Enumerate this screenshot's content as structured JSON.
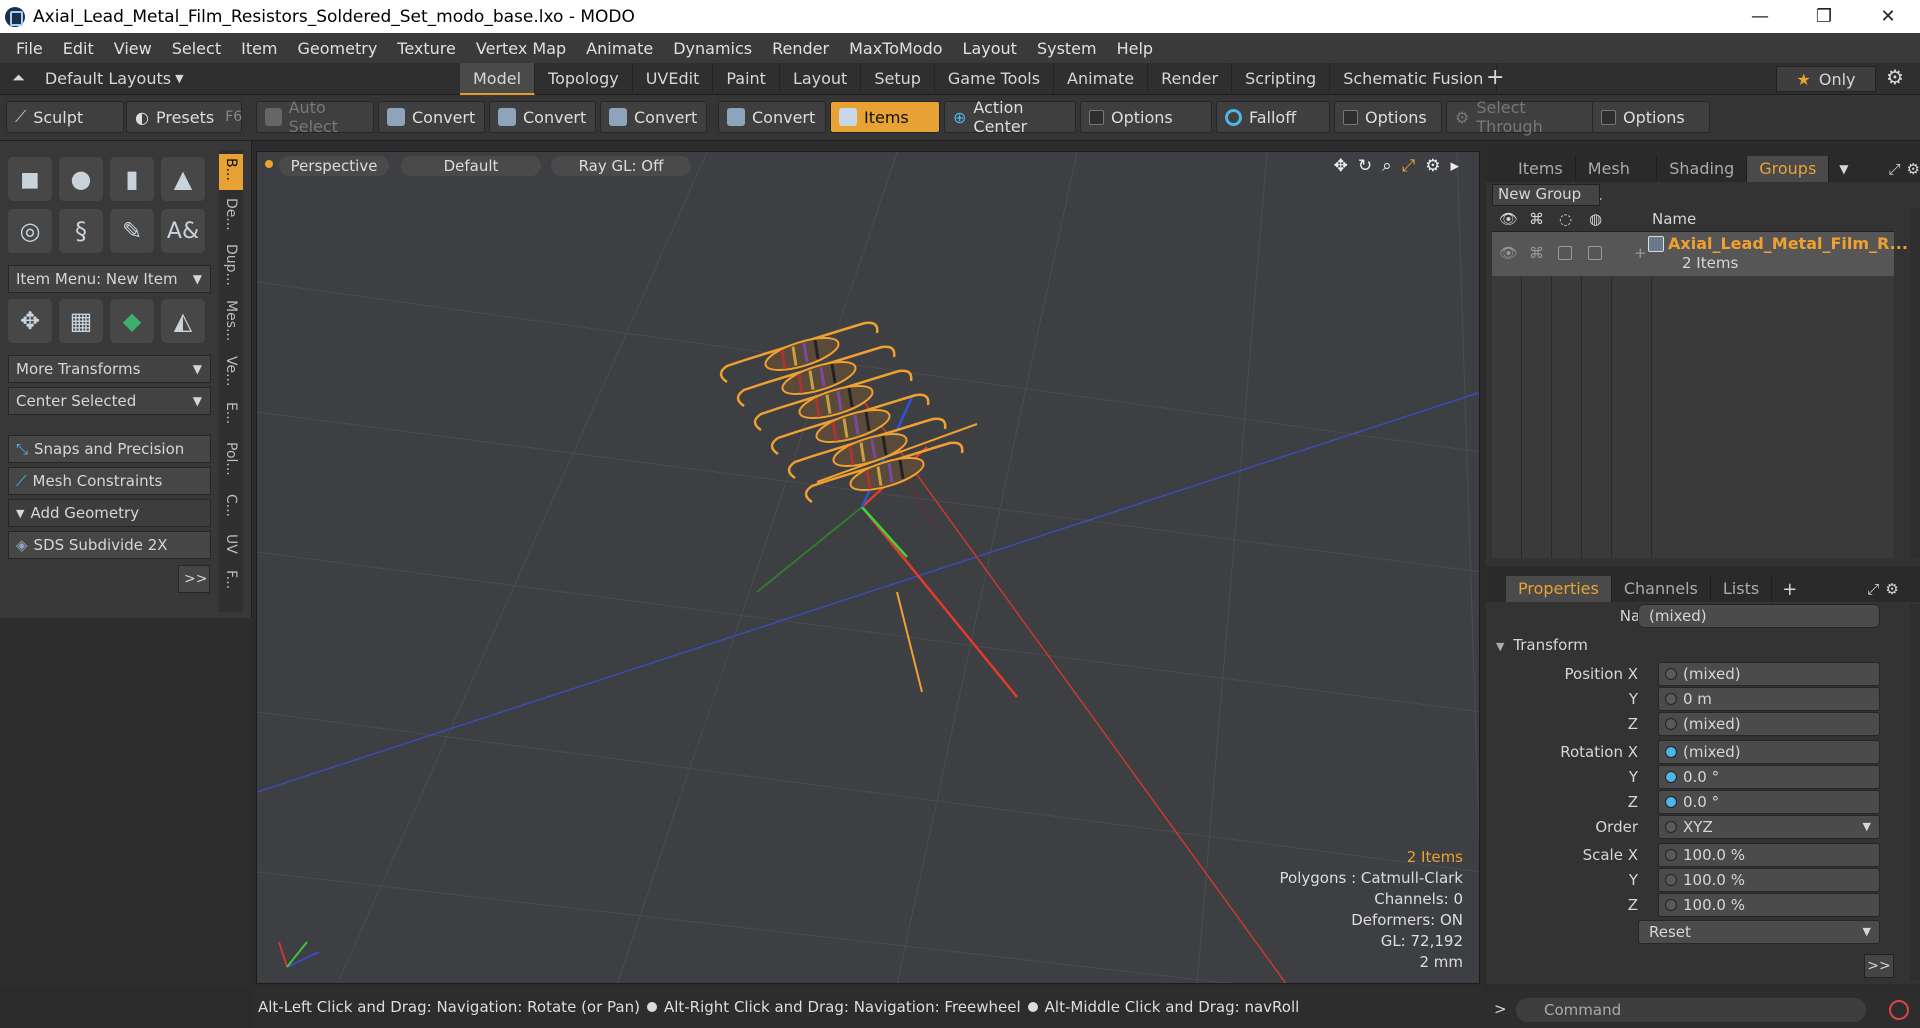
{
  "window": {
    "title": "Axial_Lead_Metal_Film_Resistors_Soldered_Set_modo_base.lxo - MODO",
    "minimize": "—",
    "maximize": "❐",
    "close": "✕"
  },
  "menu": [
    "File",
    "Edit",
    "View",
    "Select",
    "Item",
    "Geometry",
    "Texture",
    "Vertex Map",
    "Animate",
    "Dynamics",
    "Render",
    "MaxToModo",
    "Layout",
    "System",
    "Help"
  ],
  "layouts": {
    "label": "Default Layouts"
  },
  "tabs": [
    "Model",
    "Topology",
    "UVEdit",
    "Paint",
    "Layout",
    "Setup",
    "Game Tools",
    "Animate",
    "Render",
    "Scripting",
    "Schematic Fusion"
  ],
  "active_tab": "Model",
  "only_button": "Only",
  "toolbar": {
    "sculpt": "Sculpt",
    "presets": "Presets",
    "presets_key": "F6",
    "auto_select": "Auto Select",
    "convert1": "Convert",
    "convert2": "Convert",
    "convert3": "Convert",
    "convert4": "Convert",
    "items": "Items",
    "action_center": "Action Center",
    "options1": "Options",
    "falloff": "Falloff",
    "options2": "Options",
    "select_through": "Select Through",
    "options3": "Options"
  },
  "left_panel": {
    "item_menu": "Item Menu: New Item",
    "more_transforms": "More Transforms",
    "center_selected": "Center Selected",
    "snaps": "Snaps and Precision",
    "mesh_constraints": "Mesh Constraints",
    "add_geometry": "Add Geometry",
    "sds": "SDS Subdivide 2X",
    "more": ">>"
  },
  "vertical_tabs": [
    "B...",
    "De...",
    "Dup...",
    "Mes...",
    "Ve...",
    "E...",
    "Pol...",
    "C...",
    "UV",
    "F..."
  ],
  "viewport": {
    "view": "Perspective",
    "shading": "Default",
    "raygl": "Ray GL: Off",
    "info": {
      "items": "2 Items",
      "polygons": "Polygons : Catmull-Clark",
      "channels": "Channels: 0",
      "deformers": "Deformers: ON",
      "gl": "GL: 72,192",
      "scale": "2 mm"
    }
  },
  "status": {
    "a": "Alt-Left Click and Drag: Navigation: Rotate (or Pan)",
    "b": "Alt-Right Click and Drag: Navigation: Freewheel",
    "c": "Alt-Middle Click and Drag: navRoll"
  },
  "right_tabs": [
    "Items",
    "Mesh ...",
    "Shading",
    "Groups"
  ],
  "active_right_tab": "Groups",
  "groups": {
    "new_group": "New Group",
    "name_header": "Name",
    "group_name": "Axial_Lead_Metal_Film_R...",
    "group_count": "2 Items"
  },
  "props_tabs": [
    "Properties",
    "Channels",
    "Lists"
  ],
  "props": {
    "name_label": "Name",
    "name_value": "(mixed)",
    "transform": "Transform",
    "pos_x_label": "Position X",
    "pos_x": "(mixed)",
    "pos_y_label": "Y",
    "pos_y": "0 m",
    "pos_z_label": "Z",
    "pos_z": "(mixed)",
    "rot_x_label": "Rotation X",
    "rot_x": "(mixed)",
    "rot_y_label": "Y",
    "rot_y": "0.0 °",
    "rot_z_label": "Z",
    "rot_z": "0.0 °",
    "order_label": "Order",
    "order": "XYZ",
    "scale_x_label": "Scale X",
    "scale_x": "100.0 %",
    "scale_y_label": "Y",
    "scale_y": "100.0 %",
    "scale_z_label": "Z",
    "scale_z": "100.0 %",
    "reset": "Reset",
    "more": ">>"
  },
  "command": {
    "placeholder": "Command",
    "prompt": ">"
  },
  "colors": {
    "accent": "#e8a234",
    "wire": "#f0a030",
    "axis_x": "#d23b2b",
    "axis_y": "#3cc43c",
    "axis_z": "#2c55d8"
  }
}
